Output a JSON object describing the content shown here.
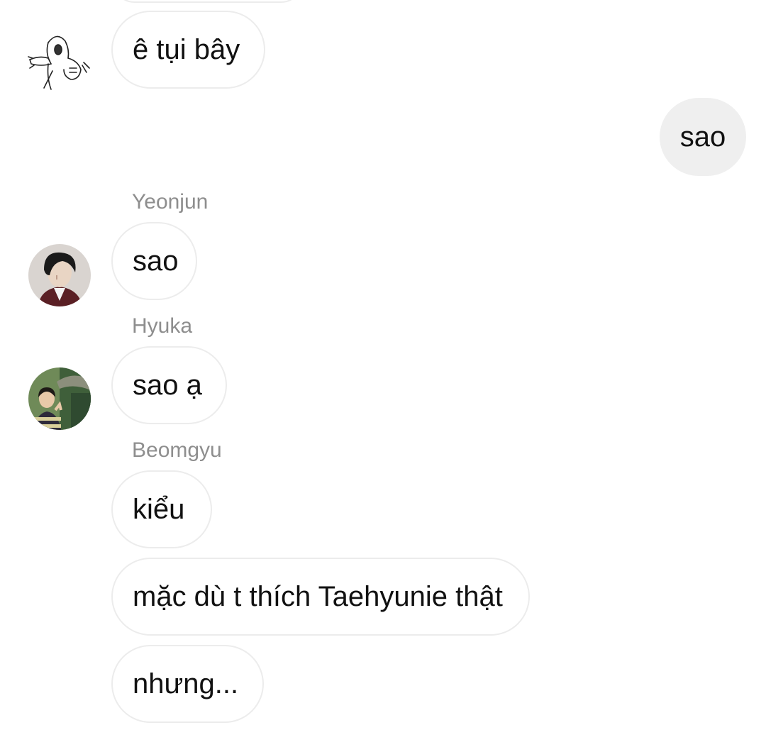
{
  "messages": [
    {
      "text": "ê tụi bây",
      "direction": "in"
    },
    {
      "text": "sao",
      "direction": "out"
    },
    {
      "sender": "Yeonjun",
      "text": "sao",
      "direction": "in"
    },
    {
      "sender": "Hyuka",
      "text": "sao ạ",
      "direction": "in"
    },
    {
      "sender": "Beomgyu",
      "text": "kiểu",
      "direction": "in"
    },
    {
      "text": "mặc dù t thích Taehyunie thật",
      "direction": "in"
    },
    {
      "text": "nhưng...",
      "direction": "in"
    }
  ],
  "colors": {
    "incoming_bubble_border": "#ececec",
    "outgoing_bubble_bg": "#efefef",
    "sender_name": "#8e8e8e",
    "text": "#111111"
  },
  "icons": {
    "avatar_1": "meme-sketch-avatar",
    "avatar_2": "yeonjun-photo-avatar",
    "avatar_3": "hyuka-photo-avatar"
  }
}
